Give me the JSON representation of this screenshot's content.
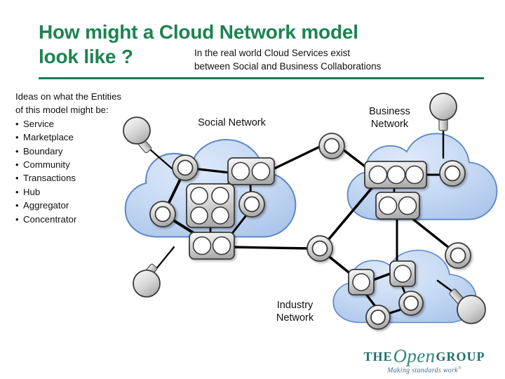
{
  "slide": {
    "title_line1": "How might a Cloud Network model",
    "title_line2": "look like ?",
    "subtitle_line1": "In the real world Cloud Services exist",
    "subtitle_line2": "between Social and Business Collaborations",
    "accent_color": "#1C8351",
    "rule_color": "#1C7A52",
    "background_color": "#FFFFFF"
  },
  "ideas": {
    "intro_line1": "Ideas on what the Entities",
    "intro_line2": "of this model might be:",
    "items": [
      "Service",
      "Marketplace",
      "Boundary",
      "Community",
      "Transactions",
      "Hub",
      "Aggregator",
      "Concentrator"
    ]
  },
  "diagram": {
    "cloud_fill_color": "#C3D8F2",
    "cloud_stroke_color": "#5B86C6",
    "node_fill_color": "#D8D8D8",
    "node_stroke_color": "#333333",
    "link_color": "#000000",
    "clouds": [
      {
        "id": "social",
        "label_line1": "Social Network",
        "label_line2": ""
      },
      {
        "id": "business",
        "label_line1": "Business",
        "label_line2": "Network"
      },
      {
        "id": "industry",
        "label_line1": "Industry",
        "label_line2": "Network"
      }
    ]
  },
  "logo": {
    "the": "THE",
    "open": "Open",
    "group": "GROUP",
    "tagline": "Making standards work",
    "registered": "®"
  }
}
